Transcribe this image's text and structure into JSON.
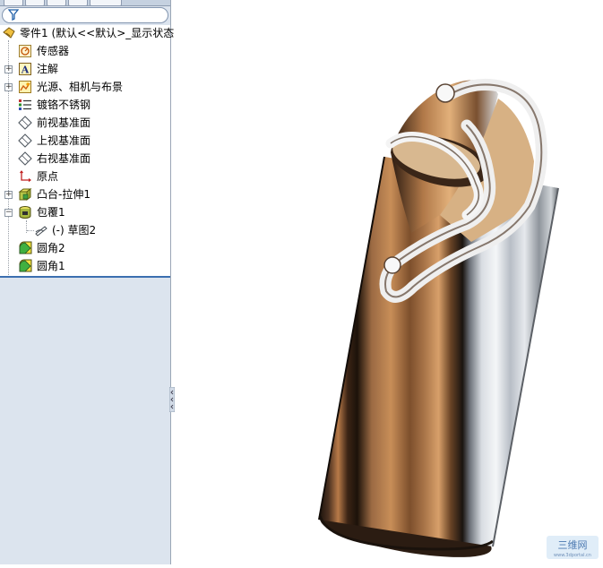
{
  "filter": {
    "icon": "filter-icon"
  },
  "tree": {
    "root": {
      "label": "零件1  (默认<<默认>_显示状态",
      "icon": "part-icon"
    },
    "items": [
      {
        "label": "传感器",
        "icon": "sensor-icon"
      },
      {
        "label": "注解",
        "icon": "annotation-icon"
      },
      {
        "label": "光源、相机与布景",
        "icon": "lights-icon"
      },
      {
        "label": "镀铬不锈钢",
        "icon": "material-icon"
      },
      {
        "label": "前视基准面",
        "icon": "plane-icon"
      },
      {
        "label": "上视基准面",
        "icon": "plane-icon"
      },
      {
        "label": "右视基准面",
        "icon": "plane-icon"
      },
      {
        "label": "原点",
        "icon": "origin-icon"
      },
      {
        "label": "凸台-拉伸1",
        "icon": "extrude-icon"
      },
      {
        "label": "包覆1",
        "icon": "wrap-icon"
      },
      {
        "label": "(-) 草图2",
        "icon": "sketch-icon"
      },
      {
        "label": "圆角2",
        "icon": "fillet-icon"
      },
      {
        "label": "圆角1",
        "icon": "fillet-icon"
      }
    ]
  },
  "watermark": {
    "text": "三维网",
    "sub": "www.3dportal.cn"
  },
  "colors": {
    "tree_bg": "#ffffff",
    "panel_bg": "#dce4ee",
    "accent": "#3c6fb0"
  }
}
